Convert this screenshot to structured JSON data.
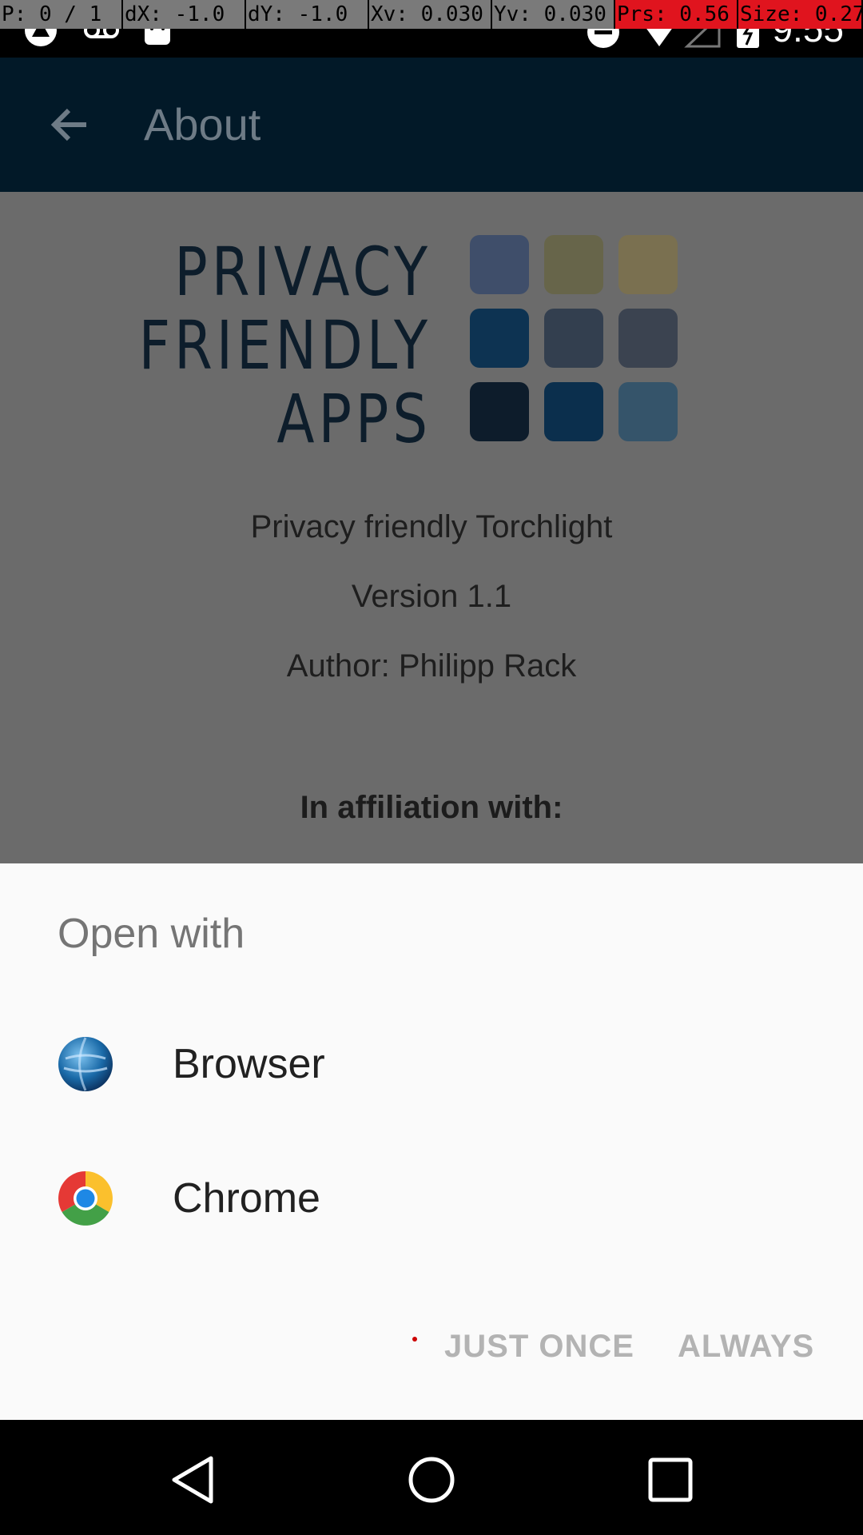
{
  "debug_overlay": [
    "P: 0 / 1",
    "dX: -1.0",
    "dY: -1.0",
    "Xv: 0.030",
    "Yv: 0.030",
    "Prs: 0.56",
    "Size: 0.27"
  ],
  "status_bar": {
    "time": "9:55"
  },
  "appbar": {
    "title": "About"
  },
  "logo": {
    "line1": "PRIVACY",
    "line2": "FRIENDLY",
    "line3": "APPS"
  },
  "about": {
    "app_name": "Privacy friendly Torchlight",
    "version": "Version 1.1",
    "author": "Author: Philipp Rack",
    "affiliation": "In affiliation with:"
  },
  "sheet": {
    "title": "Open with",
    "apps": [
      {
        "label": "Browser",
        "icon": "globe-icon"
      },
      {
        "label": "Chrome",
        "icon": "chrome-icon"
      }
    ],
    "just_once": "JUST ONCE",
    "always": "ALWAYS"
  },
  "colors": {
    "appbar": "#021928",
    "scrim": "#6b6b6b",
    "sheet": "#fafafa",
    "logo_tiles": [
      "#3f4e6a",
      "#67654a",
      "#7a7050",
      "#0d3352",
      "#333f4f",
      "#3b4350",
      "#0d1c2b",
      "#0b2f4d",
      "#35546a"
    ]
  }
}
